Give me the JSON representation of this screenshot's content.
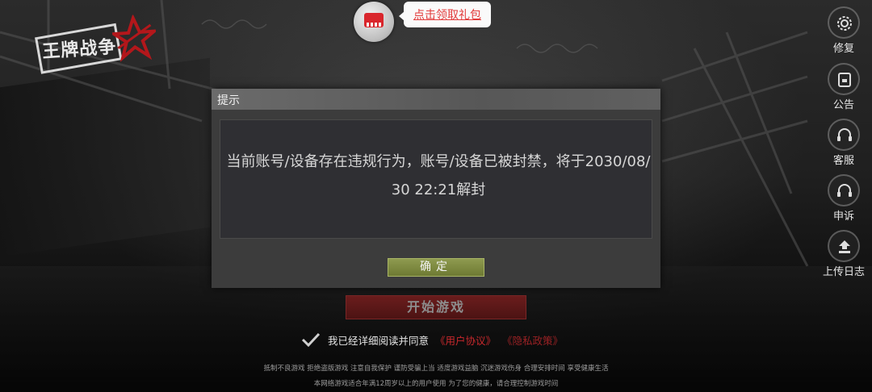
{
  "logo": {
    "text": "王牌战争"
  },
  "gift": {
    "label": "点击领取礼包",
    "icon": "gift-chest-icon"
  },
  "side_menu": [
    {
      "label": "修复",
      "icon": "gear-icon"
    },
    {
      "label": "公告",
      "icon": "notice-icon"
    },
    {
      "label": "客服",
      "icon": "headset-icon"
    },
    {
      "label": "申诉",
      "icon": "headset-icon"
    },
    {
      "label": "上传日志",
      "icon": "upload-icon"
    }
  ],
  "dialog": {
    "title": "提示",
    "message": "当前账号/设备存在违规行为，账号/设备已被封禁，将于2030/08/30 22:21解封",
    "confirm_label": "确定"
  },
  "start_button": "开始游戏",
  "agreement": {
    "checked": true,
    "text": "我已经详细阅读并同意",
    "user_agreement": "《用户协议》",
    "privacy_policy": "《隐私政策》"
  },
  "footer": {
    "line1": "抵制不良游戏 拒绝盗版游戏 注意自我保护 谨防受骗上当 适度游戏益脑 沉迷游戏伤身 合理安排时间 享受健康生活",
    "line2": "本网络游戏适合年满12周岁以上的用户使用   为了您的健康，请合理控制游戏时间"
  },
  "colors": {
    "accent_red": "#c9282c",
    "confirm_green": "#7d8a40"
  }
}
